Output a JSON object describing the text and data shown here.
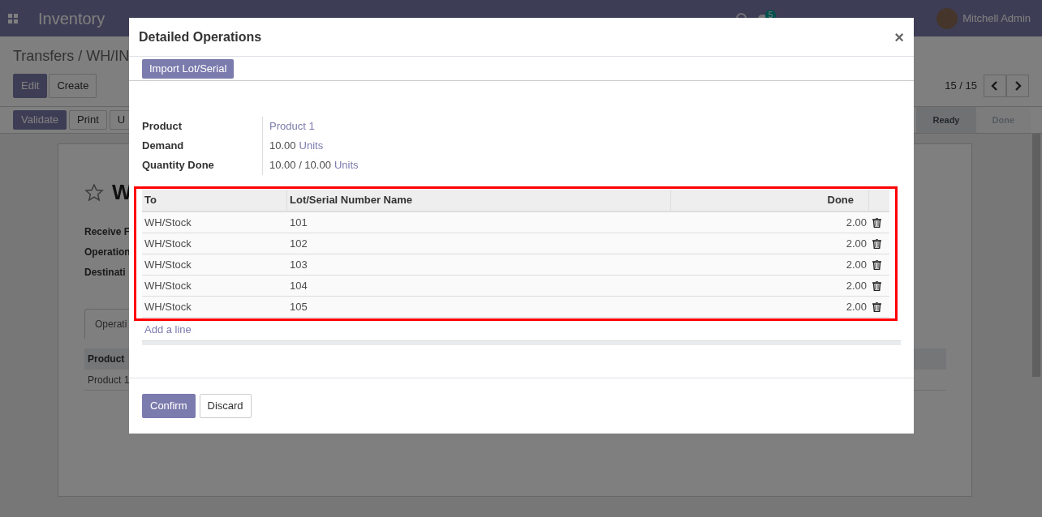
{
  "navbar": {
    "app_title": "Inventory",
    "chat_count": "5",
    "user": "Mitchell Admin"
  },
  "breadcrumb": "Transfers / WH/IN",
  "control_buttons": [
    {
      "label": "Edit",
      "primary": true
    },
    {
      "label": "Create",
      "primary": false
    }
  ],
  "pager": "15 / 15",
  "action_buttons": [
    {
      "label": "Validate",
      "primary": true
    },
    {
      "label": "Print",
      "primary": false
    },
    {
      "label": "U",
      "primary": false
    }
  ],
  "status_stages": [
    {
      "label": "Ready",
      "selected": true
    },
    {
      "label": "Done",
      "selected": false
    }
  ],
  "sheet": {
    "title": "W",
    "fields": [
      "Receive F",
      "Operation",
      "Destinati"
    ],
    "tab": "Operati",
    "table_header": "Product",
    "row": "Product 1"
  },
  "dialog": {
    "title": "Detailed Operations",
    "close": "×",
    "import_button": "Import Lot/Serial",
    "fields": [
      {
        "label": "Product",
        "link": "Product 1"
      },
      {
        "label": "Demand",
        "value": "10.00",
        "unit": "Units"
      },
      {
        "label": "Quantity Done",
        "value": "10.00 / 10.00",
        "unit": "Units"
      }
    ],
    "table": {
      "columns": [
        "To",
        "Lot/Serial Number Name",
        "Done"
      ],
      "rows": [
        {
          "to": "WH/Stock",
          "lot": "101",
          "done": "2.00"
        },
        {
          "to": "WH/Stock",
          "lot": "102",
          "done": "2.00"
        },
        {
          "to": "WH/Stock",
          "lot": "103",
          "done": "2.00"
        },
        {
          "to": "WH/Stock",
          "lot": "104",
          "done": "2.00"
        },
        {
          "to": "WH/Stock",
          "lot": "105",
          "done": "2.00"
        }
      ]
    },
    "add_line": "Add a line",
    "footer_buttons": [
      {
        "label": "Confirm",
        "primary": true
      },
      {
        "label": "Discard",
        "primary": false
      }
    ]
  }
}
